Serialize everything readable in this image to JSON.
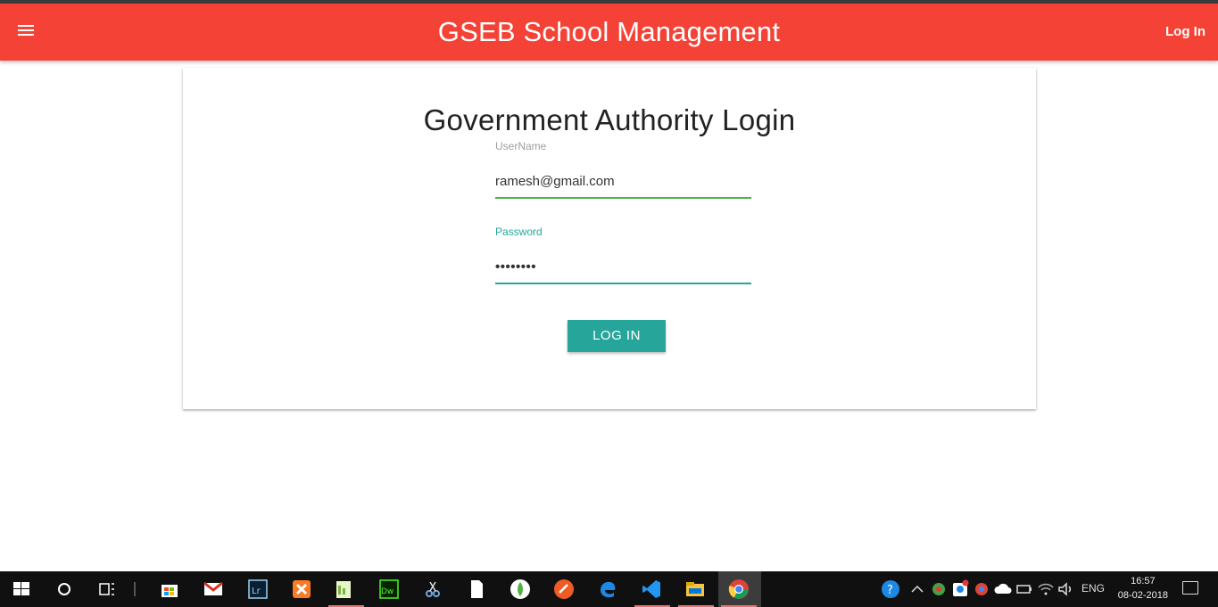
{
  "appbar": {
    "title": "GSEB School Management",
    "login_link": "Log In",
    "menu_icon": "hamburger-menu-icon",
    "color": "#f44336"
  },
  "form": {
    "heading": "Government Authority Login",
    "username_label": "UserName",
    "username_value": "ramesh@gmail.com",
    "password_label": "Password",
    "password_value": "••••••••",
    "submit_label": "LOG IN",
    "accent": "#26a69a"
  },
  "taskbar": {
    "icons": [
      "windows-start-icon",
      "cortana-icon",
      "task-view-icon",
      "store-icon",
      "gmail-icon",
      "lightroom-icon",
      "xampp-icon",
      "notepad-plus-icon",
      "dreamweaver-icon",
      "snipping-tool-icon",
      "file-icon",
      "mongodb-icon",
      "postman-icon",
      "edge-icon",
      "vscode-icon",
      "file-explorer-icon",
      "chrome-icon"
    ],
    "tray": {
      "language": "ENG",
      "time": "16:57",
      "date": "08-02-2018"
    }
  }
}
